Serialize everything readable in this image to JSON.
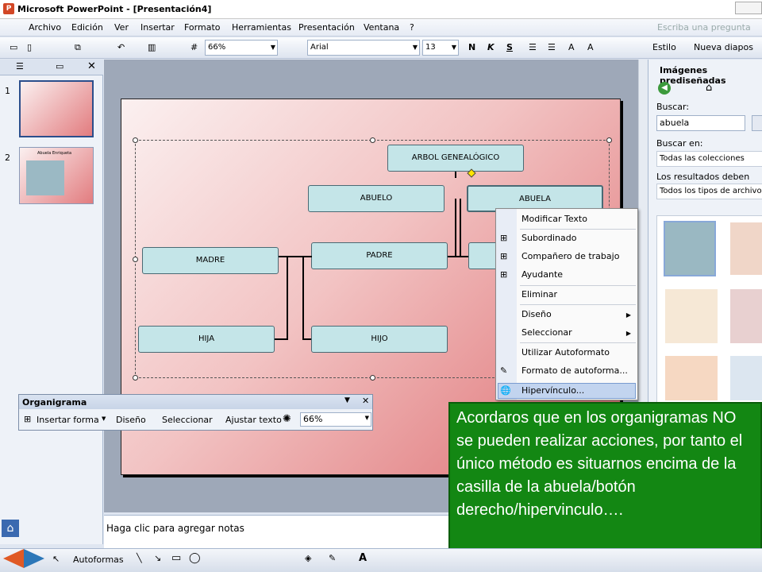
{
  "window": {
    "title": "Microsoft PowerPoint - [Presentación4]"
  },
  "menus": [
    "Archivo",
    "Edición",
    "Ver",
    "Insertar",
    "Formato",
    "Herramientas",
    "Presentación",
    "Ventana",
    "?"
  ],
  "help_placeholder": "Escriba una pregunta",
  "toolbar": {
    "zoom": "66%",
    "font": "Arial",
    "size": "13",
    "bold": "N",
    "italic": "K",
    "shadow": "S",
    "estilo": "Estilo",
    "nueva": "Nueva diapos"
  },
  "slides_panel": {
    "thumb2_title": "Abuela Enriqueta"
  },
  "slide_numbers": [
    "1",
    "2"
  ],
  "org": {
    "title": "ARBOL GENEALÓGICO",
    "abuelo": "ABUELO",
    "abuela": "ABUELA",
    "madre": "MADRE",
    "padre": "PADRE",
    "hija": "HIJA",
    "hijo": "HIJO"
  },
  "context_menu": [
    "Modificar Texto",
    "Subordinado",
    "Compañero de trabajo",
    "Ayudante",
    "Eliminar",
    "Diseño",
    "Seleccionar",
    "Utilizar Autoformato",
    "Formato de autoforma...",
    "Hipervínculo..."
  ],
  "notes_placeholder": "Haga clic para agregar notas",
  "taskpane": {
    "title": "Imágenes prediseñadas",
    "buscar_label": "Buscar:",
    "buscar_value": "abuela",
    "buscar_en_label": "Buscar en:",
    "buscar_en_value": "Todas las colecciones",
    "resultados_label": "Los resultados deben ser:",
    "resultados_value": "Todos los tipos de archivos"
  },
  "orgbar": {
    "title": "Organigrama",
    "insertar": "Insertar forma",
    "diseno": "Diseño",
    "seleccionar": "Seleccionar",
    "ajustar": "Ajustar texto",
    "zoom": "66%"
  },
  "callout": "Acordaros que en los organigramas NO se pueden realizar acciones, por tanto el único método es situarnos encima de la casilla de la abuela/botón derecho/hipervinculo….",
  "drawbar": {
    "autoformas": "Autoformas"
  },
  "colors": {
    "callout_bg": "#138713",
    "box_fill": "#c4e5e8"
  }
}
